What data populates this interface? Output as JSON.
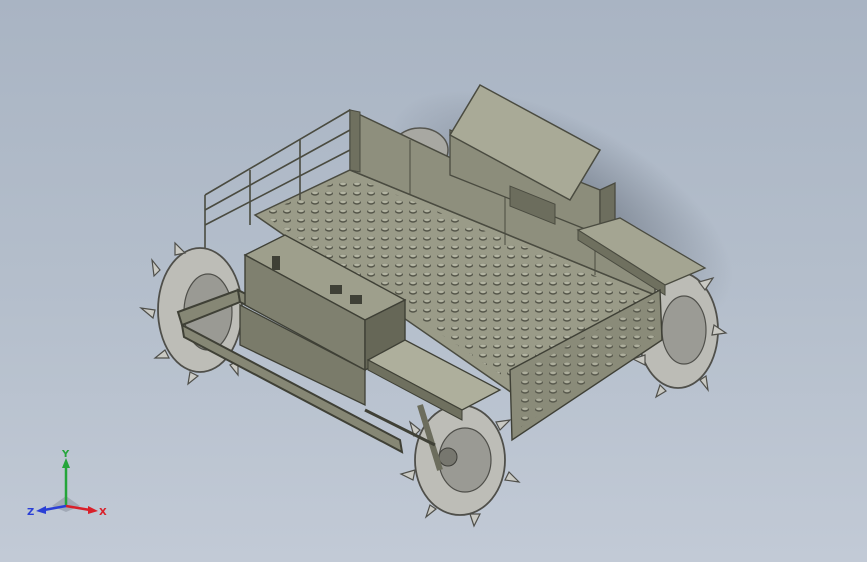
{
  "viewport": {
    "background_top": "#a9b4c3",
    "background_bottom": "#c2cad6"
  },
  "model": {
    "body_color": "#8b8c7a",
    "body_light": "#a7a895",
    "body_dark": "#5e5f52",
    "tire_color": "#b9b9b4",
    "tire_dark": "#6d6d68"
  },
  "triad": {
    "x_label": "X",
    "y_label": "Y",
    "z_label": "Z",
    "x_color": "#d9202a",
    "y_color": "#24a53a",
    "z_color": "#2a3fd6"
  }
}
